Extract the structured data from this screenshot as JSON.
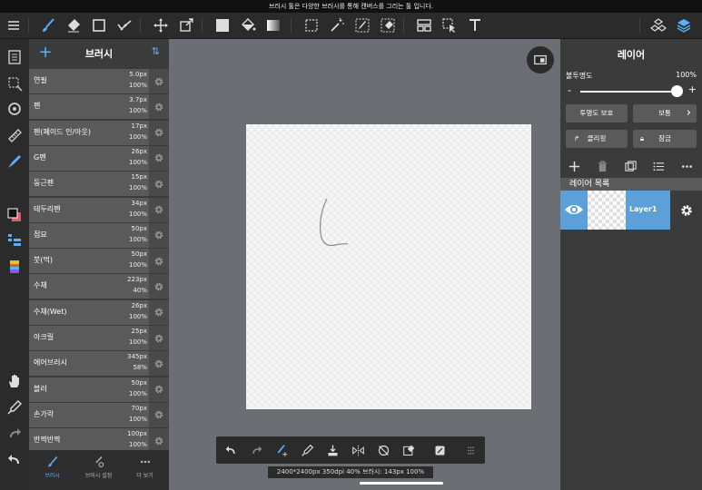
{
  "tooltip": "브러시 툴은 다양한 브러시를 통해 캔버스를 그리는 툴 입니다.",
  "colors": {
    "accent": "#5ab0ff",
    "panel": "#3b3b3b",
    "toolbar": "#2b2b2b",
    "layer_selected": "#5da0d8",
    "canvas_bg": "#6b6f74"
  },
  "toolbar": {
    "icons": [
      "menu-icon",
      "brush-icon",
      "eraser-icon",
      "rectangle-icon",
      "stroke-correction-icon",
      "move-icon",
      "transform-icon",
      "fill-color-icon",
      "bucket-icon",
      "gradient-icon",
      "select-icon",
      "magic-wand-icon",
      "select-pen-icon",
      "select-eraser-icon",
      "layout-icon",
      "operation-icon",
      "text-icon",
      "materials-icon",
      "layers-icon"
    ]
  },
  "brush_panel": {
    "title": "브러시",
    "add": "+",
    "sort": "⇅",
    "brushes": [
      {
        "name": "연필",
        "size": "5.0px",
        "opacity": "100%"
      },
      {
        "name": "펜",
        "size": "3.7px",
        "opacity": "100%"
      },
      {
        "name": "펜(페이드 인/아웃)",
        "size": "17px",
        "opacity": "100%"
      },
      {
        "name": "G펜",
        "size": "26px",
        "opacity": "100%"
      },
      {
        "name": "둥근펜",
        "size": "15px",
        "opacity": "100%"
      },
      {
        "name": "테두리펜",
        "size": "34px",
        "opacity": "100%"
      },
      {
        "name": "점묘",
        "size": "50px",
        "opacity": "100%"
      },
      {
        "name": "붓(먹)",
        "size": "50px",
        "opacity": "100%"
      },
      {
        "name": "수채",
        "size": "223px",
        "opacity": "40%"
      },
      {
        "name": "수채(Wet)",
        "size": "26px",
        "opacity": "100%"
      },
      {
        "name": "아크릴",
        "size": "25px",
        "opacity": "100%"
      },
      {
        "name": "에어브러시",
        "size": "345px",
        "opacity": "58%"
      },
      {
        "name": "블러",
        "size": "50px",
        "opacity": "100%"
      },
      {
        "name": "손가락",
        "size": "70px",
        "opacity": "100%"
      },
      {
        "name": "반짝반짝",
        "size": "100px",
        "opacity": "100%"
      }
    ],
    "tabs": [
      {
        "label": "브러시",
        "icon": "brush-icon"
      },
      {
        "label": "브러시 설정",
        "icon": "brush-settings-icon"
      },
      {
        "label": "더 보기",
        "icon": "more-icon"
      }
    ]
  },
  "status": "2400*2400px 350dpi 40% 브러시: 143px 100%",
  "layer_panel": {
    "title": "레이어",
    "opacity_label": "불투명도",
    "opacity_value": "100%",
    "opacity_fraction": 1.0,
    "minus": "-",
    "plus": "+",
    "protect_alpha": "투명도 보호",
    "blend_mode": "보통",
    "blend_chevron": "›",
    "clipping": "클리핑",
    "lock": "잠금",
    "section": "레이어 목록",
    "layers": [
      {
        "name": "Layer1",
        "visible": true
      }
    ]
  }
}
